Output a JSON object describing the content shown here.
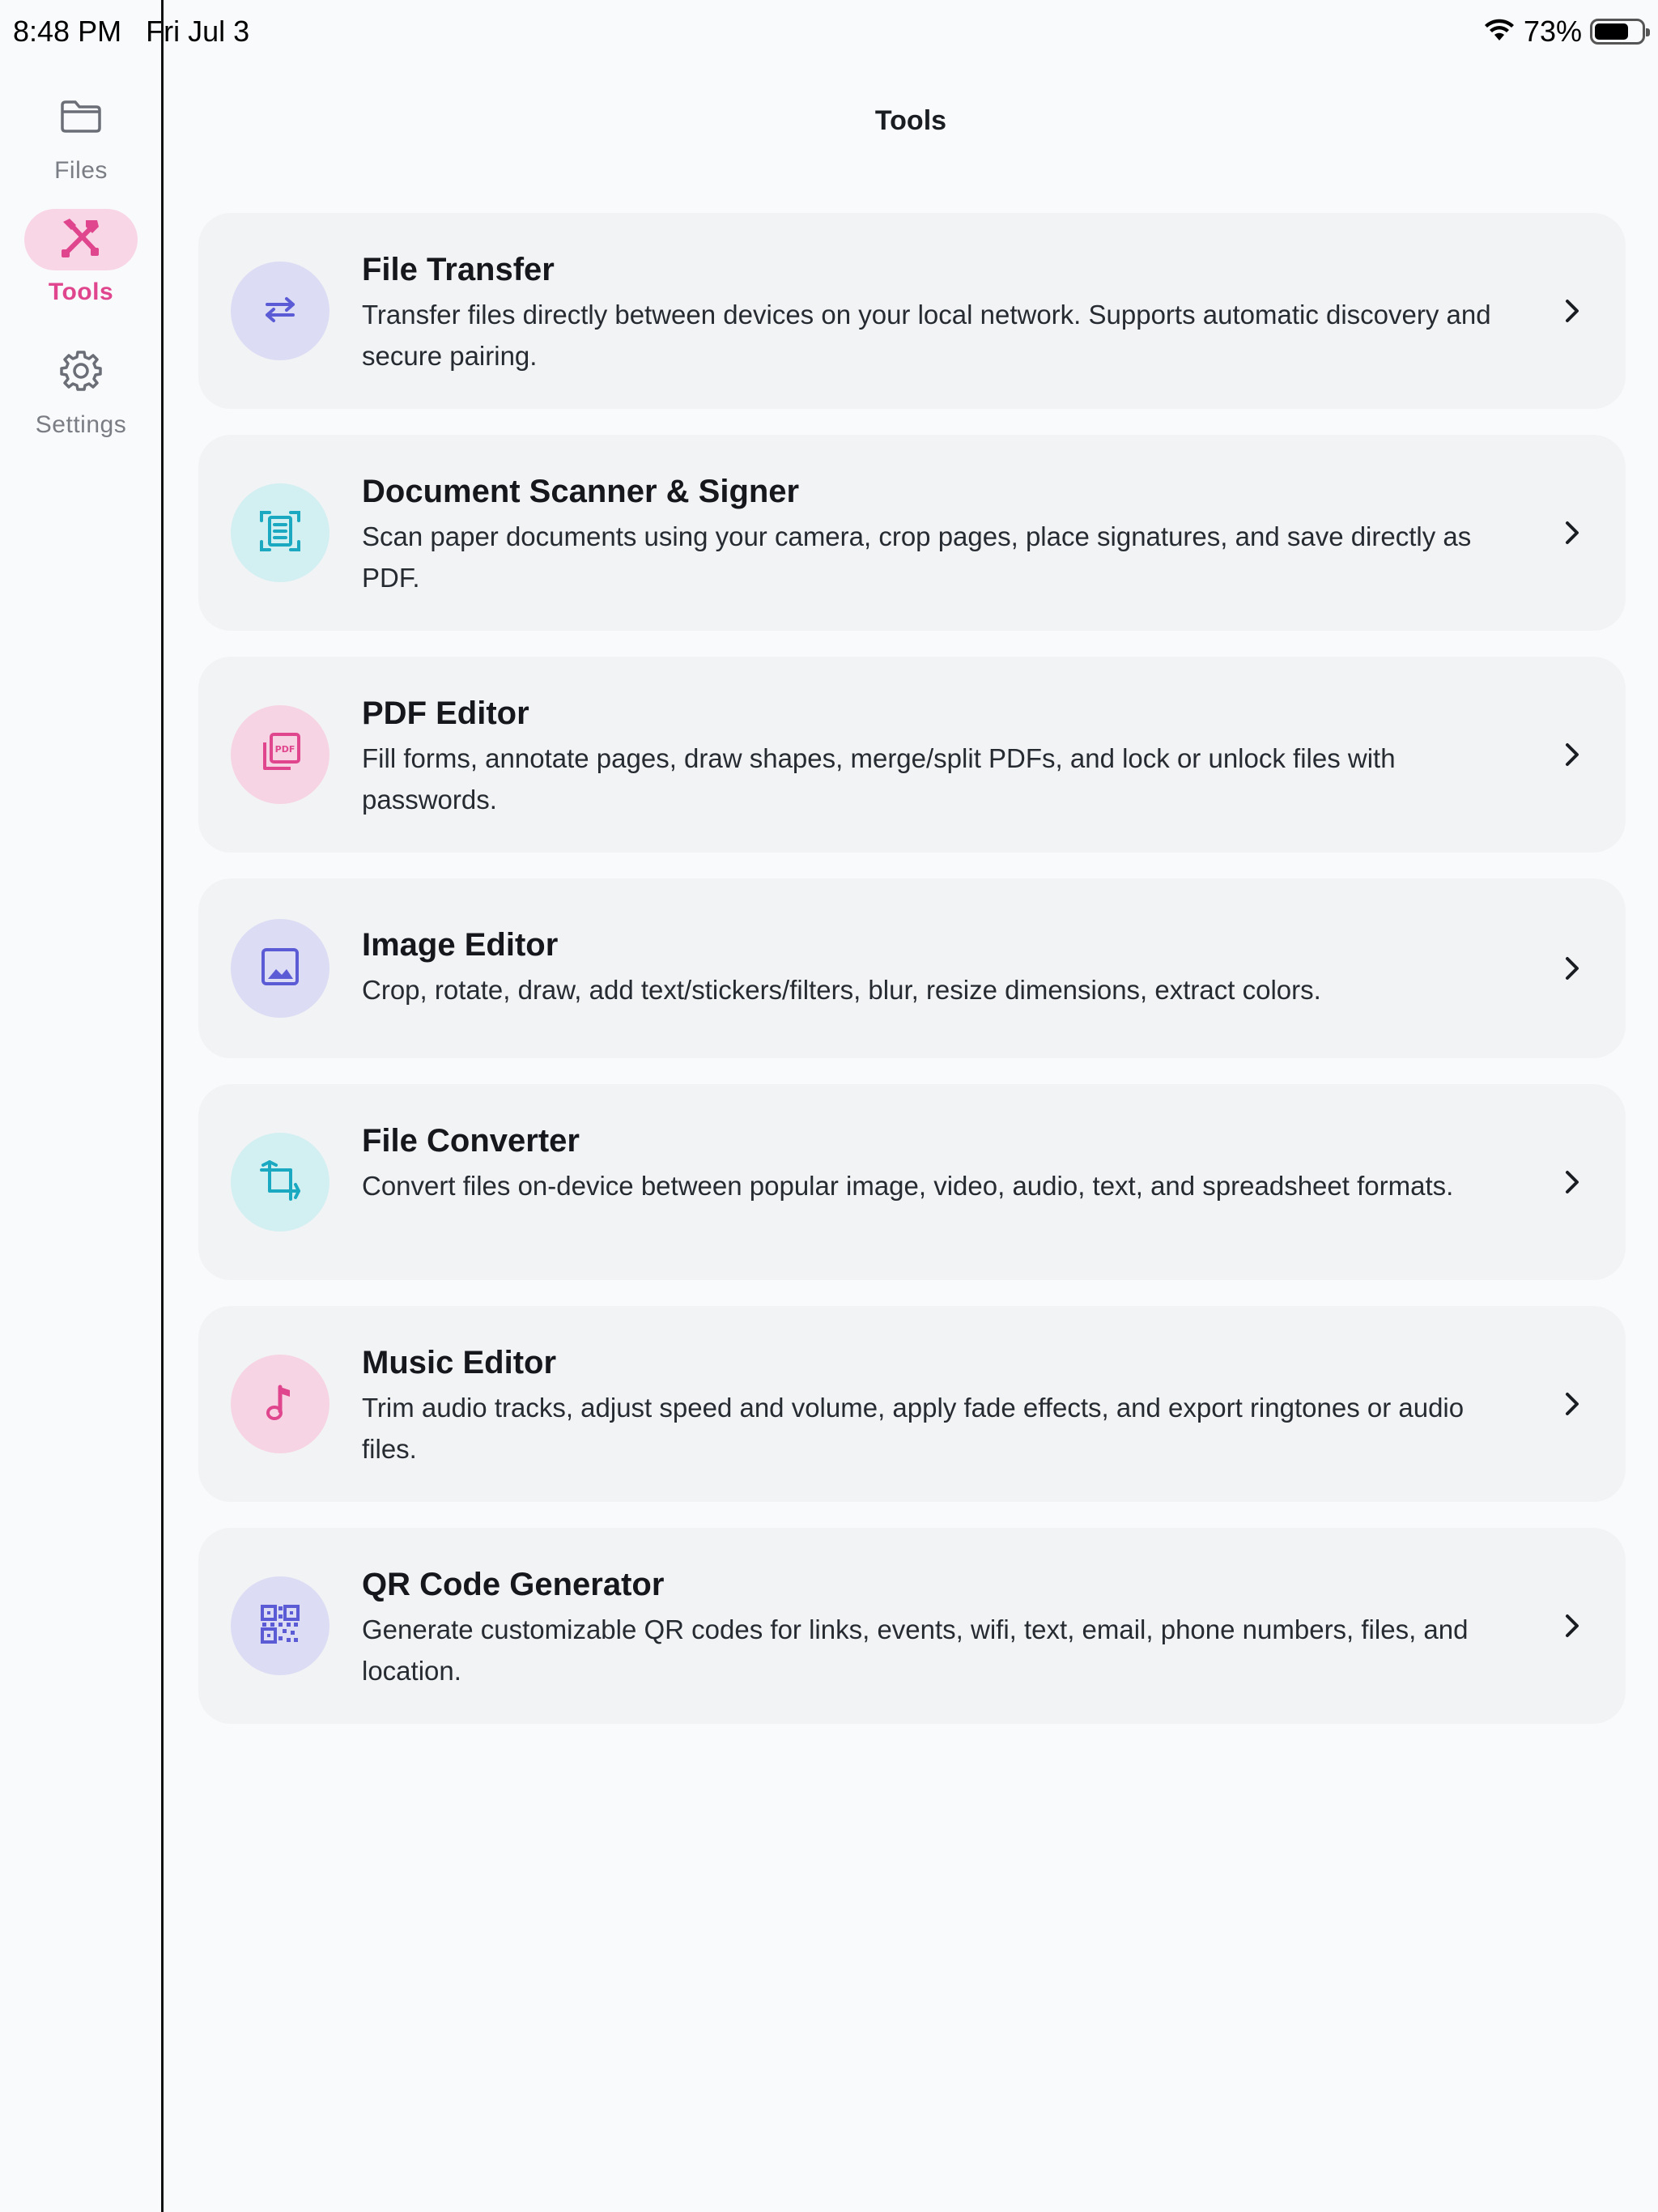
{
  "status_bar": {
    "time": "8:48 PM",
    "date": "Fri Jul 3",
    "battery_percent": "73%",
    "battery_level": 0.73
  },
  "sidebar": {
    "items": [
      {
        "label": "Files",
        "icon": "folder-icon",
        "active": false
      },
      {
        "label": "Tools",
        "icon": "tools-icon",
        "active": true
      },
      {
        "label": "Settings",
        "icon": "gear-icon",
        "active": false
      }
    ]
  },
  "header": {
    "title": "Tools"
  },
  "tools": [
    {
      "title": "File Transfer",
      "description": "Transfer files directly between devices on your local network. Supports automatic discovery and secure pairing.",
      "icon": "transfer-arrows-icon",
      "accent": "#5b5bd6"
    },
    {
      "title": "Document Scanner & Signer",
      "description": "Scan paper documents using your camera, crop pages, place signatures, and save directly as PDF.",
      "icon": "document-scan-icon",
      "accent": "#1aa9c0"
    },
    {
      "title": "PDF Editor",
      "description": "Fill forms, annotate pages, draw shapes, merge/split PDFs, and lock or unlock files with passwords.",
      "icon": "pdf-icon",
      "accent": "#e0468e"
    },
    {
      "title": "Image Editor",
      "description": "Crop, rotate, draw, add text/stickers/filters, blur, resize dimensions, extract colors.",
      "icon": "image-icon",
      "accent": "#5b5bd6"
    },
    {
      "title": "File Converter",
      "description": "Convert files on-device between popular image, video, audio, text, and spreadsheet formats.",
      "icon": "crop-icon",
      "accent": "#1aa9c0"
    },
    {
      "title": "Music Editor",
      "description": "Trim audio tracks, adjust speed and volume, apply fade effects, and export ringtones or audio files.",
      "icon": "music-note-icon",
      "accent": "#e0468e"
    },
    {
      "title": "QR Code Generator",
      "description": "Generate customizable QR codes for links, events, wifi, text, email, phone numbers, files, and location.",
      "icon": "qr-code-icon",
      "accent": "#5b5bd6"
    }
  ]
}
